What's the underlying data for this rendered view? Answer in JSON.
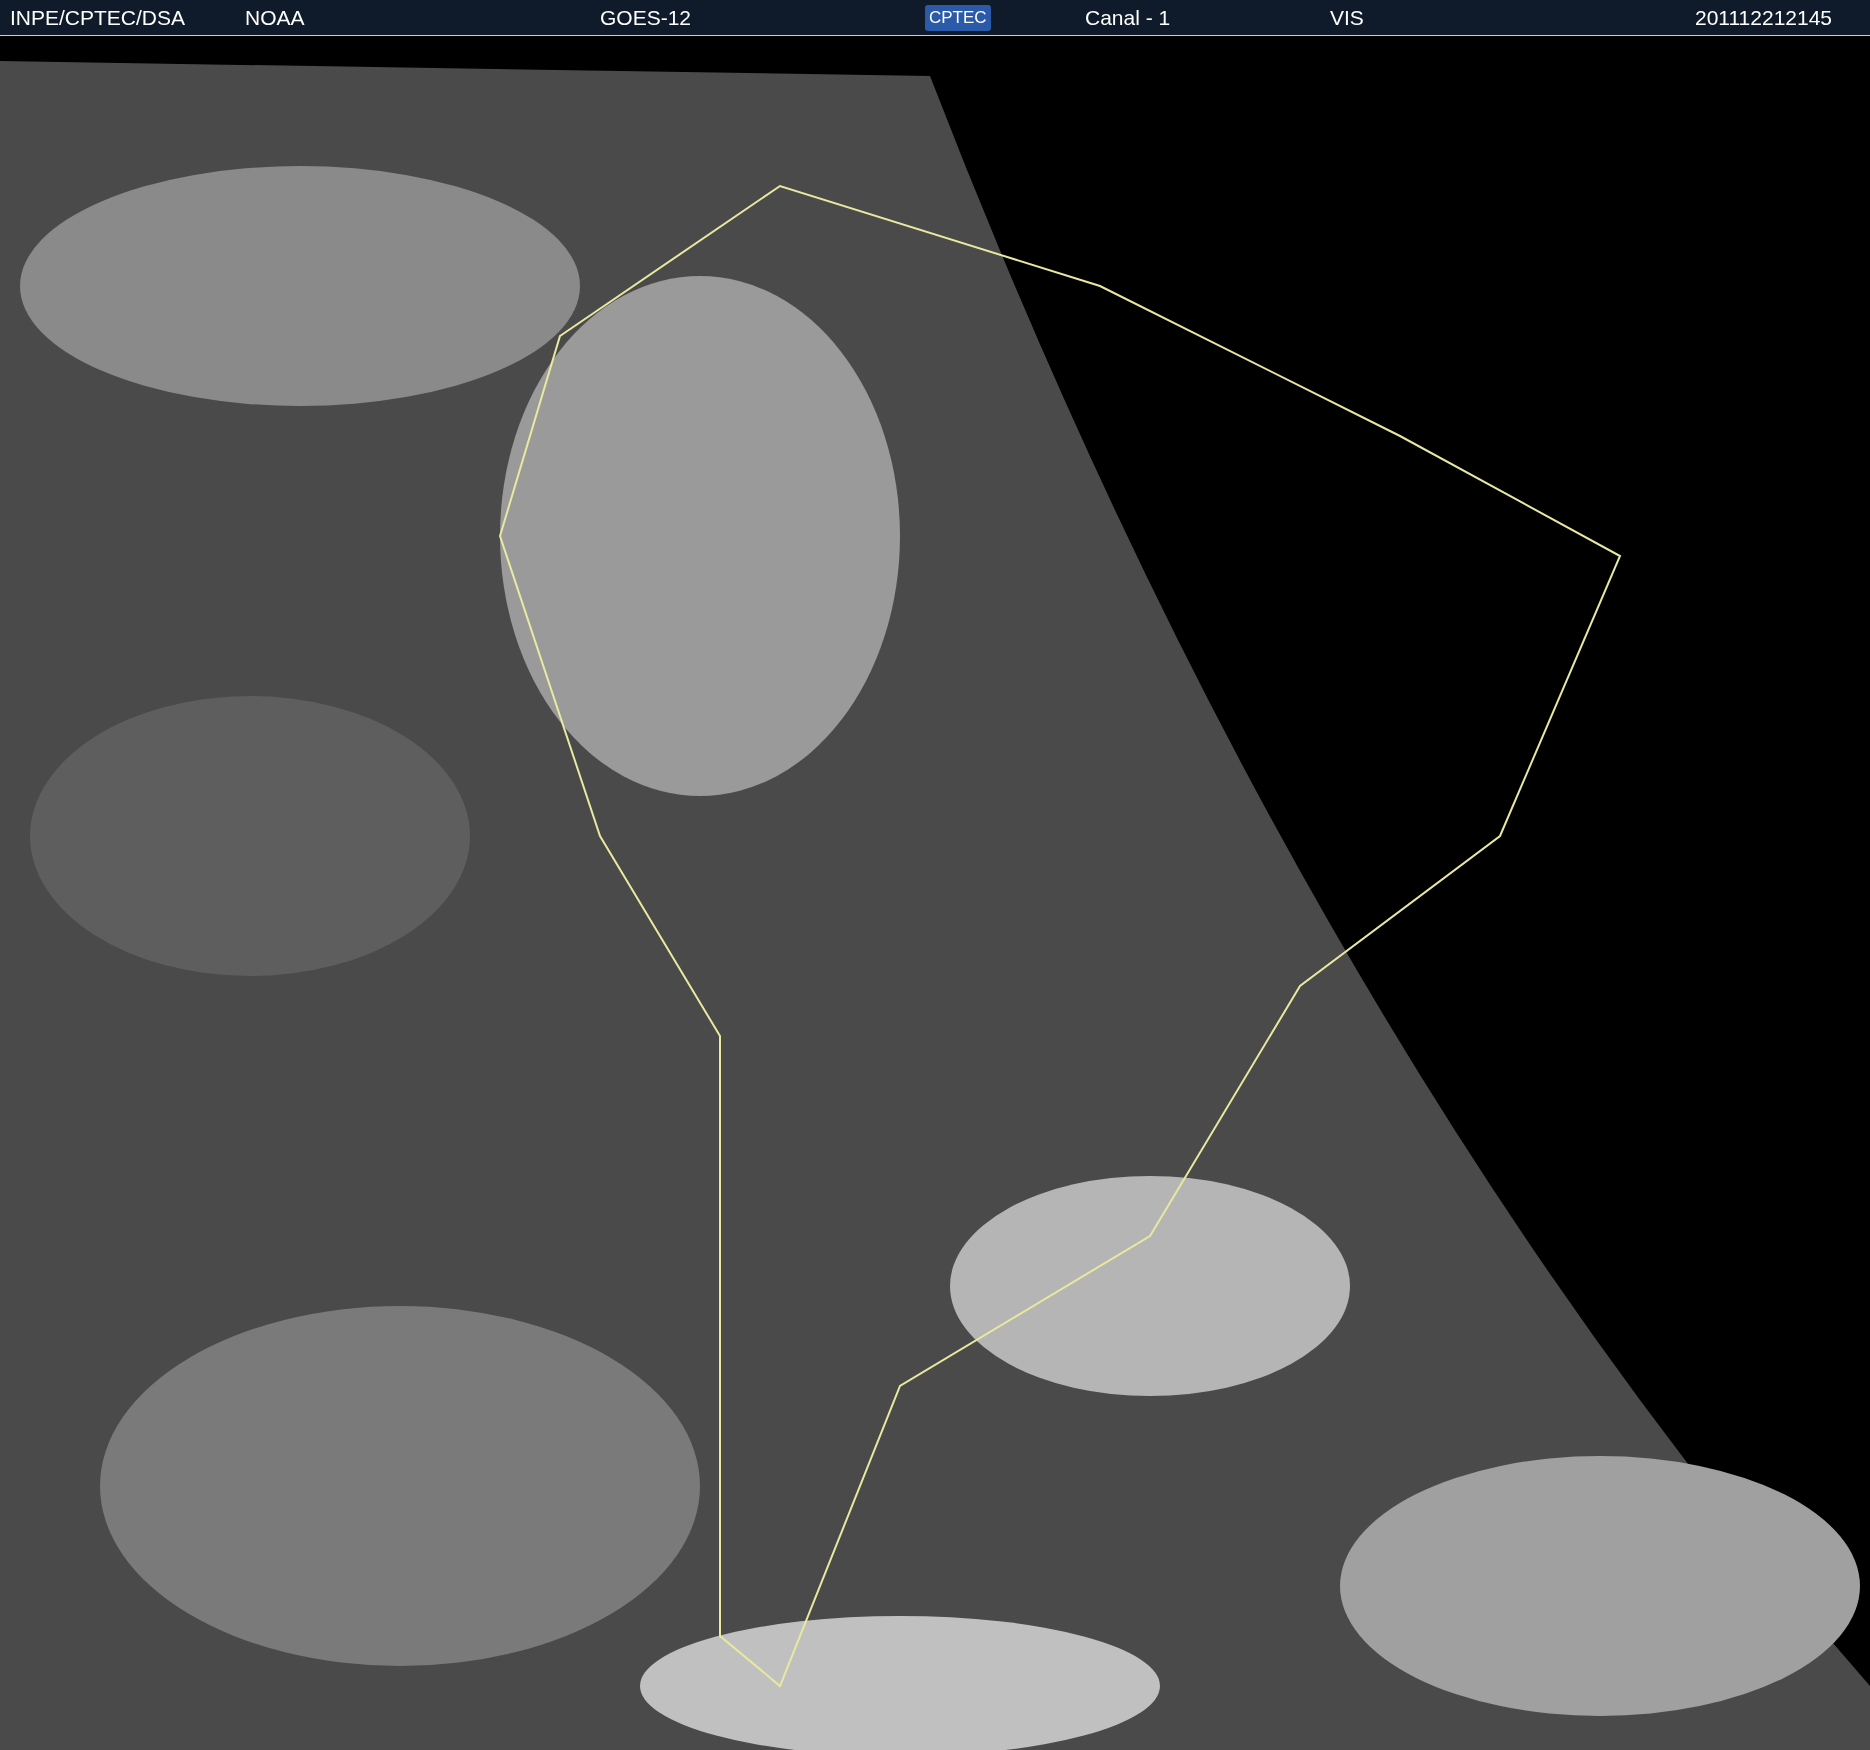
{
  "header": {
    "items": [
      {
        "kind": "text",
        "text": "INPE/CPTEC/DSA"
      },
      {
        "kind": "text",
        "text": "NOAA"
      },
      {
        "kind": "text",
        "text": "GOES-12"
      },
      {
        "kind": "logo",
        "text": "CPTEC"
      },
      {
        "kind": "text",
        "text": "Canal - 1"
      },
      {
        "kind": "text",
        "text": "VIS"
      },
      {
        "kind": "text",
        "text": "201112212145"
      }
    ]
  }
}
